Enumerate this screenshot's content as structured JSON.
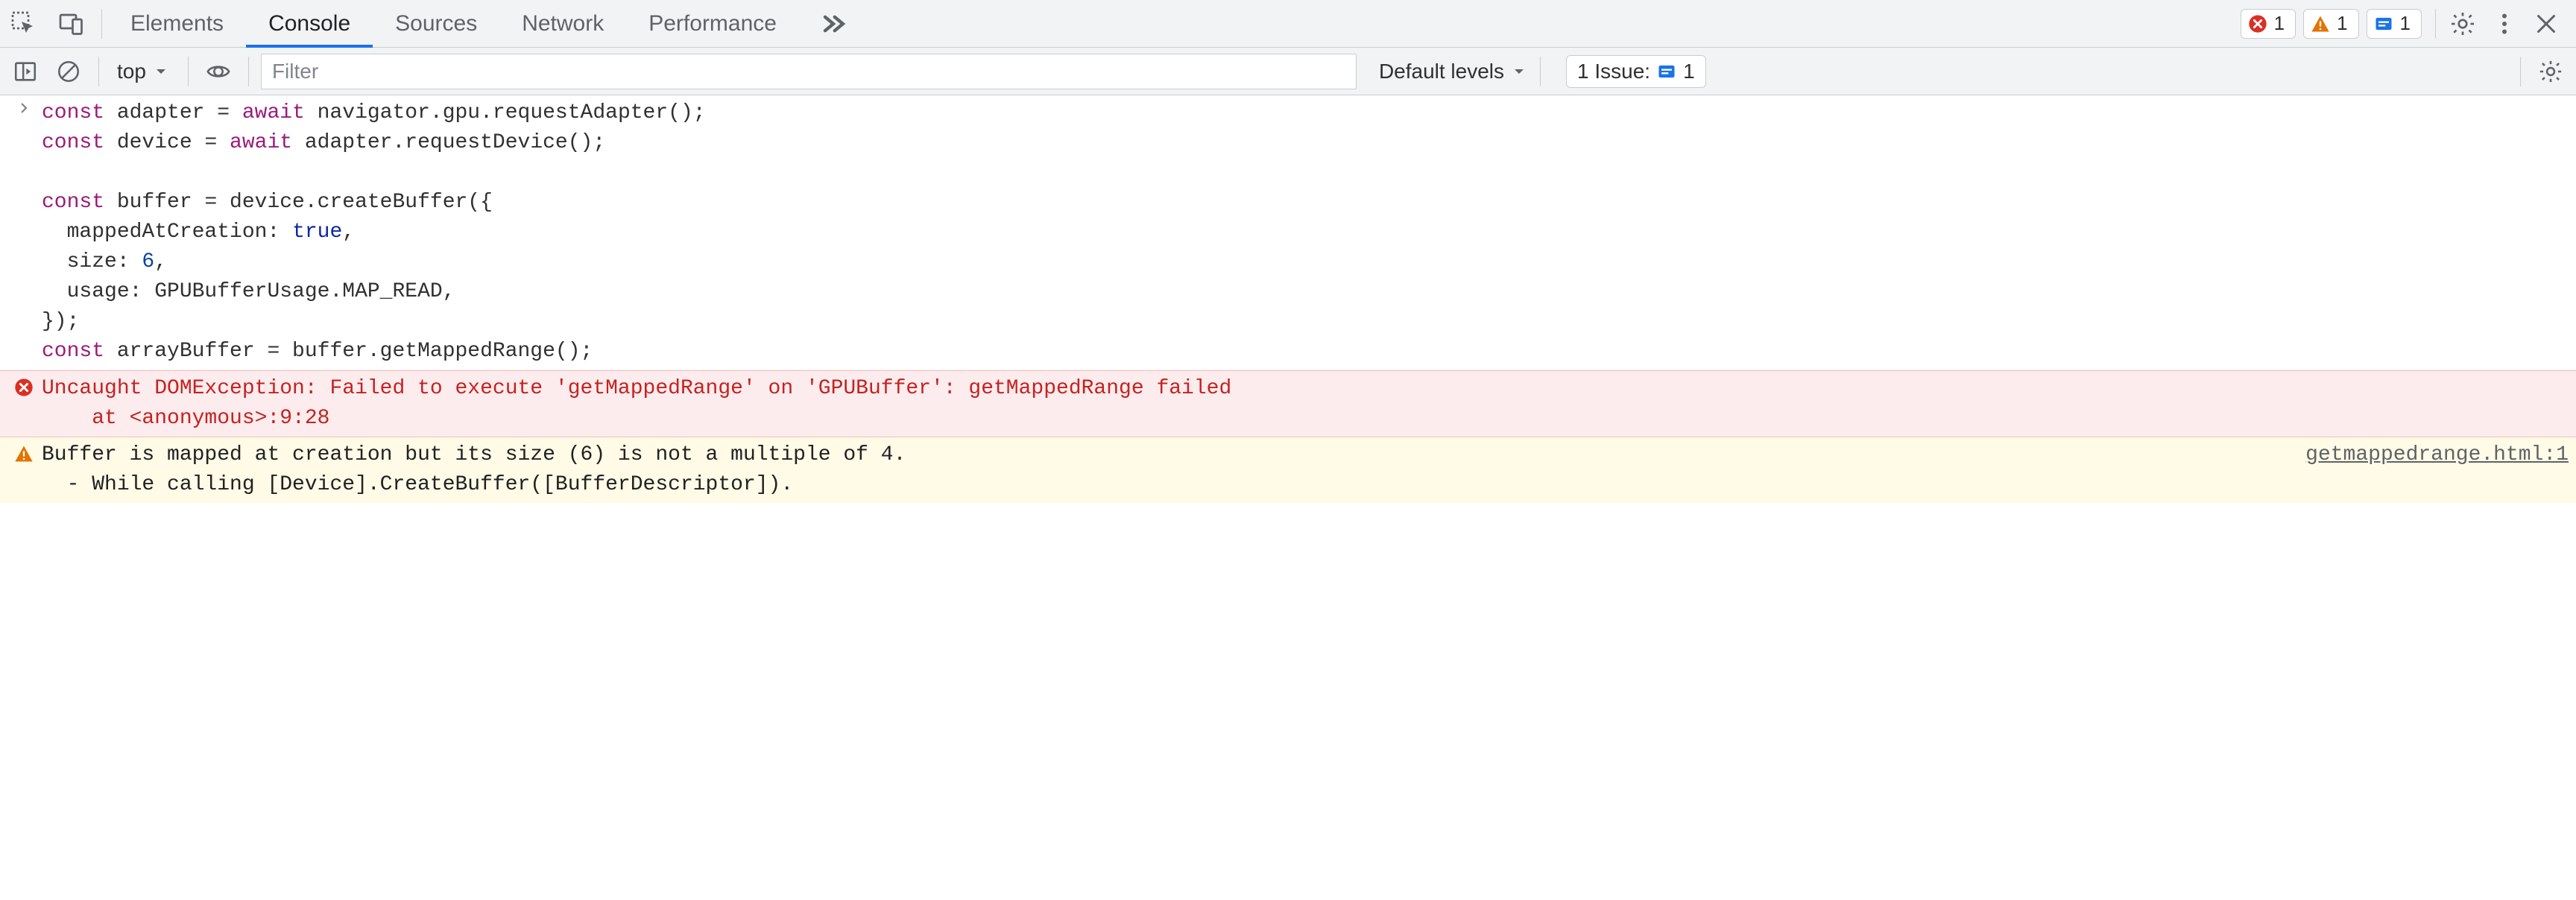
{
  "tabs": {
    "elements": "Elements",
    "console": "Console",
    "sources": "Sources",
    "network": "Network",
    "performance": "Performance"
  },
  "badges": {
    "error_count": "1",
    "warn_count": "1",
    "info_count": "1"
  },
  "consolebar": {
    "context": "top",
    "filter_placeholder": "Filter",
    "levels": "Default levels",
    "issues_label": "1 Issue:",
    "issues_count": "1"
  },
  "code": {
    "l1a": "const",
    "l1b": " adapter = ",
    "l1c": "await",
    "l1d": " navigator.gpu.requestAdapter();",
    "l2a": "const",
    "l2b": " device = ",
    "l2c": "await",
    "l2d": " adapter.requestDevice();",
    "l3": "",
    "l4a": "const",
    "l4b": " buffer = device.createBuffer({",
    "l5a": "  mappedAtCreation: ",
    "l5b": "true",
    "l5c": ",",
    "l6a": "  size: ",
    "l6b": "6",
    "l6c": ",",
    "l7": "  usage: GPUBufferUsage.MAP_READ,",
    "l8": "});",
    "l9a": "const",
    "l9b": " arrayBuffer = buffer.getMappedRange();"
  },
  "error": {
    "line1": "Uncaught DOMException: Failed to execute 'getMappedRange' on 'GPUBuffer': getMappedRange failed",
    "line2": "    at <anonymous>:9:28"
  },
  "warning": {
    "line1": "Buffer is mapped at creation but its size (6) is not a multiple of 4.",
    "line2": "  - While calling [Device].CreateBuffer([BufferDescriptor]).",
    "source": "getmappedrange.html:1"
  }
}
